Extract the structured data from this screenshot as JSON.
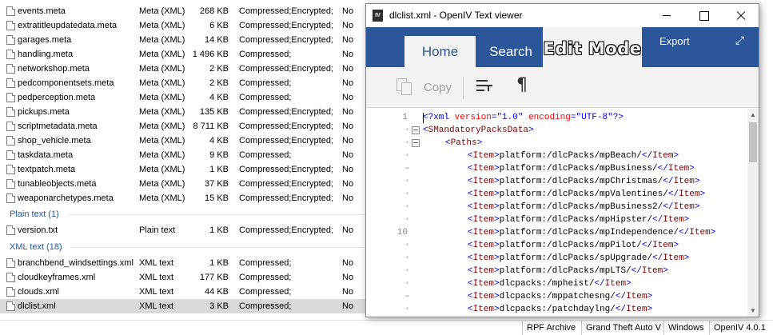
{
  "file_list": {
    "meta_rows": [
      {
        "name": "events.meta",
        "type": "Meta (XML)",
        "size": "268 KB",
        "attributes": "Compressed;Encrypted;",
        "encrypted": "No"
      },
      {
        "name": "extratitleupdatedata.meta",
        "type": "Meta (XML)",
        "size": "6 KB",
        "attributes": "Compressed;Encrypted;",
        "encrypted": "No"
      },
      {
        "name": "garages.meta",
        "type": "Meta (XML)",
        "size": "14 KB",
        "attributes": "Compressed;Encrypted;",
        "encrypted": "No"
      },
      {
        "name": "handling.meta",
        "type": "Meta (XML)",
        "size": "1 496 KB",
        "attributes": "Compressed;",
        "encrypted": "No"
      },
      {
        "name": "networkshop.meta",
        "type": "Meta (XML)",
        "size": "2 KB",
        "attributes": "Compressed;Encrypted;",
        "encrypted": "No"
      },
      {
        "name": "pedcomponentsets.meta",
        "type": "Meta (XML)",
        "size": "2 KB",
        "attributes": "Compressed;",
        "encrypted": "No"
      },
      {
        "name": "pedperception.meta",
        "type": "Meta (XML)",
        "size": "4 KB",
        "attributes": "Compressed;",
        "encrypted": "No"
      },
      {
        "name": "pickups.meta",
        "type": "Meta (XML)",
        "size": "135 KB",
        "attributes": "Compressed;Encrypted;",
        "encrypted": "No"
      },
      {
        "name": "scriptmetadata.meta",
        "type": "Meta (XML)",
        "size": "8 711 KB",
        "attributes": "Compressed;Encrypted;",
        "encrypted": "No"
      },
      {
        "name": "shop_vehicle.meta",
        "type": "Meta (XML)",
        "size": "4 KB",
        "attributes": "Compressed;Encrypted;",
        "encrypted": "No"
      },
      {
        "name": "taskdata.meta",
        "type": "Meta (XML)",
        "size": "9 KB",
        "attributes": "Compressed;",
        "encrypted": "No"
      },
      {
        "name": "textpatch.meta",
        "type": "Meta (XML)",
        "size": "1 KB",
        "attributes": "Compressed;Encrypted;",
        "encrypted": "No"
      },
      {
        "name": "tunableobjects.meta",
        "type": "Meta (XML)",
        "size": "37 KB",
        "attributes": "Compressed;Encrypted;",
        "encrypted": "No"
      },
      {
        "name": "weaponarchetypes.meta",
        "type": "Meta (XML)",
        "size": "15 KB",
        "attributes": "Compressed;Encrypted;",
        "encrypted": "No"
      }
    ],
    "plain_text_header": "Plain text (1)",
    "plain_rows": [
      {
        "name": "version.txt",
        "type": "Plain text",
        "size": "1 KB",
        "attributes": "Compressed;Encrypted;",
        "encrypted": "No"
      }
    ],
    "xml_header": "XML text (18)",
    "xml_rows": [
      {
        "name": "branchbend_windsettings.xml",
        "type": "XML text",
        "size": "1 KB",
        "attributes": "Compressed;",
        "encrypted": "No"
      },
      {
        "name": "cloudkeyframes.xml",
        "type": "XML text",
        "size": "177 KB",
        "attributes": "Compressed;",
        "encrypted": "No"
      },
      {
        "name": "clouds.xml",
        "type": "XML text",
        "size": "44 KB",
        "attributes": "Compressed;",
        "encrypted": "No"
      },
      {
        "name": "dlclist.xml",
        "type": "XML text",
        "size": "3 KB",
        "attributes": "Compressed;",
        "encrypted": "No"
      }
    ]
  },
  "status_bar": [
    "RPF Archive",
    "Grand Theft Auto V",
    "Windows",
    "OpenIV 4.0.1"
  ],
  "viewer": {
    "title": "dlclist.xml - OpenIV Text viewer",
    "app_icon_text": "IV",
    "tabs": {
      "home": "Home",
      "search": "Search",
      "edit_mode": "Edit Mode"
    },
    "export_label": "Export",
    "expand_glyph": "⤢",
    "toolbar": {
      "copy_label": "Copy",
      "pilcrow": "¶"
    },
    "gutter": {
      "line_1": "1",
      "line_10": "10",
      "dot": "·",
      "dash": "–"
    },
    "code": {
      "line1": {
        "lt": "<?",
        "decl": "xml",
        "attr1": "version",
        "eq1": "=",
        "val1": "\"1.0\"",
        "attr2": "encoding",
        "eq2": "=",
        "val2": "\"UTF-8\"",
        "end": "?>"
      },
      "root_tag": "SMandatoryPacksData",
      "paths_tag": "Paths",
      "item_tag": "Item",
      "items": [
        "platform:/dlcPacks/mpBeach/",
        "platform:/dlcPacks/mpBusiness/",
        "platform:/dlcPacks/mpChristmas/",
        "platform:/dlcPacks/mpValentines/",
        "platform:/dlcPacks/mpBusiness2/",
        "platform:/dlcPacks/mpHipster/",
        "platform:/dlcPacks/mpIndependence/",
        "platform:/dlcPacks/mpPilot/",
        "platform:/dlcPacks/spUpgrade/",
        "platform:/dlcPacks/mpLTS/",
        "dlcpacks:/mpheist/",
        "dlcpacks:/mppatchesng/",
        "dlcpacks:/patchdaylng/"
      ]
    },
    "scroll": {
      "up": "▲",
      "down": "▼"
    }
  },
  "colors": {
    "ribbon": "#2b579a",
    "tab_bg": "#f3f3f3",
    "xml_tag": "#800000",
    "xml_punct": "#0000cc",
    "group_header": "#1e5aa8",
    "selected_row": "#d9d9d9"
  }
}
